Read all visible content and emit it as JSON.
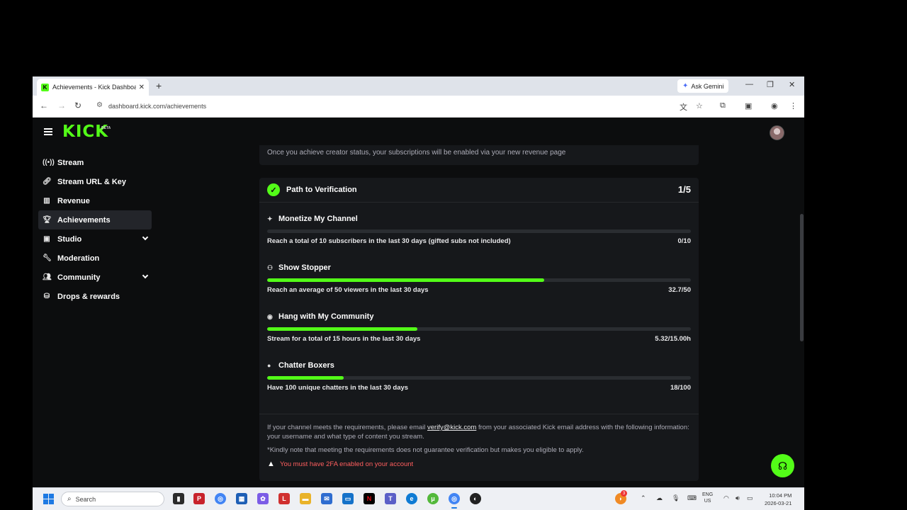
{
  "browser": {
    "tab_title": "Achievements - Kick Dashboard",
    "tab_close": "✕",
    "new_tab": "+",
    "gemini_label": "Ask Gemini",
    "url": "dashboard.kick.com/achievements"
  },
  "app": {
    "logo": "KICK",
    "beta": "BETA"
  },
  "sidebar": {
    "items": [
      {
        "label": "Stream",
        "icon": "broadcast-icon"
      },
      {
        "label": "Stream URL & Key",
        "icon": "link-icon"
      },
      {
        "label": "Revenue",
        "icon": "chart-icon"
      },
      {
        "label": "Achievements",
        "icon": "trophy-icon"
      },
      {
        "label": "Studio",
        "icon": "studio-icon"
      },
      {
        "label": "Moderation",
        "icon": "wrench-icon"
      },
      {
        "label": "Community",
        "icon": "community-icon"
      },
      {
        "label": "Drops & rewards",
        "icon": "drops-icon"
      }
    ]
  },
  "top_card": {
    "info": "Once you achieve creator status, your subscriptions will be enabled via your new revenue page"
  },
  "verification": {
    "title": "Path to Verification",
    "count": "1/5",
    "achievements": [
      {
        "title": "Monetize My Channel",
        "desc": "Reach a total of 10 subscribers in the last 30 days (gifted subs not included)",
        "value": "0/10",
        "progress": 0.0
      },
      {
        "title": "Show Stopper",
        "desc": "Reach an average of 50 viewers in the last 30 days",
        "value": "32.7/50",
        "progress": 0.654
      },
      {
        "title": "Hang with My Community",
        "desc": "Stream for a total of 15 hours in the last 30 days",
        "value": "5.32/15.00h",
        "progress": 0.355
      },
      {
        "title": "Chatter Boxers",
        "desc": "Have 100 unique chatters in the last 30 days",
        "value": "18/100",
        "progress": 0.18
      }
    ],
    "footer_pre": "If your channel meets the requirements, please email ",
    "footer_email": "verify@kick.com",
    "footer_post": " from your associated Kick email address with the following information: your username and what type of content you stream.",
    "note": "*Kindly note that meeting the requirements does not guarantee verification but makes you eligible to apply.",
    "warning": "You must have 2FA enabled on your account"
  },
  "taskbar": {
    "search": "Search",
    "lang_1": "ENG",
    "lang_2": "US",
    "time": "10:04 PM",
    "date": "2026-03-21",
    "badge": "3"
  },
  "colors": {
    "accent": "#53fc18",
    "warning": "#ff5e5e",
    "panel": "#16181b",
    "background": "#0c0d0e"
  }
}
